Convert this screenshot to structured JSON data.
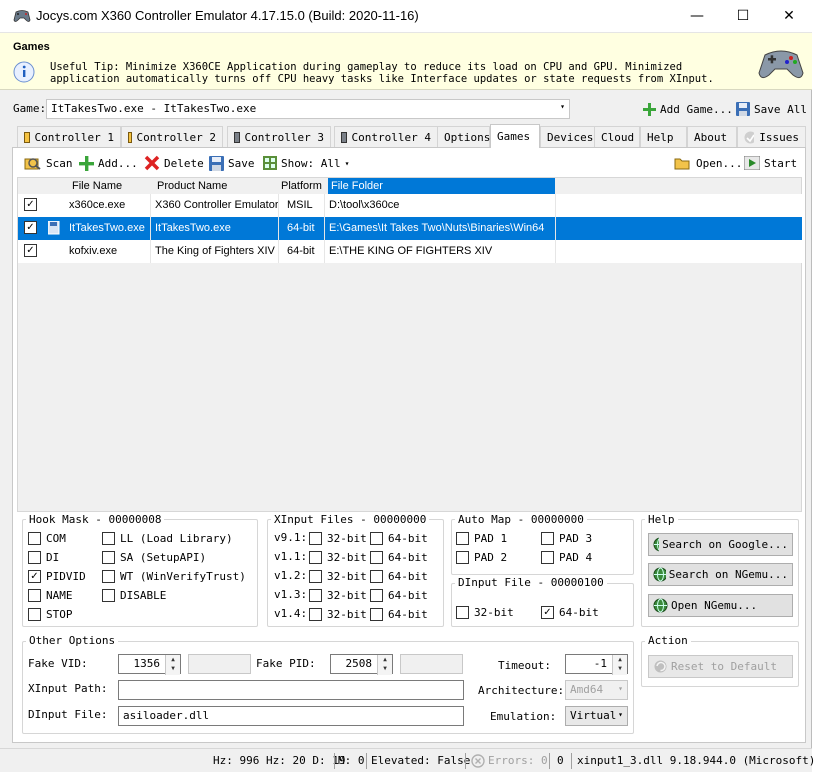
{
  "window": {
    "title": "Jocys.com X360 Controller Emulator 4.17.15.0 (Build: 2020-11-16)",
    "minimize": "—",
    "maximize": "☐",
    "close": "✕"
  },
  "info": {
    "title": "Games",
    "text": "Useful Tip: Minimize X360CE Application during gameplay to reduce its load on CPU and GPU. Minimized application automatically turns off CPU heavy tasks like Interface updates or state requests from XInput."
  },
  "game_bar": {
    "label": "Game:",
    "selected": "ItTakesTwo.exe - ItTakesTwo.exe",
    "add_game": "Add Game...",
    "save_all": "Save All"
  },
  "tabs": [
    {
      "label": "Controller 1",
      "active": false
    },
    {
      "label": "Controller 2",
      "active": false
    },
    {
      "label": "Controller 3",
      "active": false
    },
    {
      "label": "Controller 4",
      "active": false
    },
    {
      "label": "Options",
      "active": false
    },
    {
      "label": "Games",
      "active": true
    },
    {
      "label": "Devices",
      "active": false
    },
    {
      "label": "Cloud",
      "active": false
    },
    {
      "label": "Help",
      "active": false
    },
    {
      "label": "About",
      "active": false
    },
    {
      "label": "Issues",
      "active": false
    }
  ],
  "toolbar": {
    "scan": "Scan",
    "add": "Add...",
    "delete": "Delete",
    "save": "Save",
    "show": "Show: All",
    "open": "Open...",
    "start": "Start"
  },
  "grid": {
    "columns": [
      "File Name",
      "Product Name",
      "Platform",
      "File Folder"
    ],
    "rows": [
      {
        "checked": true,
        "file": "x360ce.exe",
        "product": "X360 Controller Emulator",
        "platform": "MSIL",
        "folder": "D:\\tool\\x360ce",
        "selected": false
      },
      {
        "checked": true,
        "file": "ItTakesTwo.exe",
        "product": "ItTakesTwo.exe",
        "platform": "64-bit",
        "folder": "E:\\Games\\It Takes Two\\Nuts\\Binaries\\Win64",
        "selected": true
      },
      {
        "checked": true,
        "file": "kofxiv.exe",
        "product": "The King of Fighters XIV",
        "platform": "64-bit",
        "folder": "E:\\THE KING OF FIGHTERS XIV",
        "selected": false
      }
    ]
  },
  "hook_mask": {
    "title": "Hook Mask - 00000008",
    "items": [
      {
        "label": "COM",
        "checked": false
      },
      {
        "label": "LL (Load Library)",
        "checked": false
      },
      {
        "label": "DI",
        "checked": false
      },
      {
        "label": "SA (SetupAPI)",
        "checked": false
      },
      {
        "label": "PIDVID",
        "checked": true
      },
      {
        "label": "WT (WinVerifyTrust)",
        "checked": false
      },
      {
        "label": "NAME",
        "checked": false
      },
      {
        "label": "DISABLE",
        "checked": false
      },
      {
        "label": "STOP",
        "checked": false
      }
    ]
  },
  "xinput_files": {
    "title": "XInput Files - 00000000",
    "rows": [
      {
        "version": "v9.1:",
        "b32": "32-bit",
        "b64": "64-bit"
      },
      {
        "version": "v1.1:",
        "b32": "32-bit",
        "b64": "64-bit"
      },
      {
        "version": "v1.2:",
        "b32": "32-bit",
        "b64": "64-bit"
      },
      {
        "version": "v1.3:",
        "b32": "32-bit",
        "b64": "64-bit"
      },
      {
        "version": "v1.4:",
        "b32": "32-bit",
        "b64": "64-bit"
      }
    ]
  },
  "auto_map": {
    "title": "Auto Map - 00000000",
    "pads": [
      "PAD 1",
      "PAD 3",
      "PAD 2",
      "PAD 4"
    ]
  },
  "dinput_file": {
    "title": "DInput File - 00000100",
    "b32": "32-bit",
    "b64": "64-bit"
  },
  "help": {
    "title": "Help",
    "google": "Search on Google...",
    "ngemu": "Search on NGemu...",
    "open_ngemu": "Open NGemu..."
  },
  "action": {
    "title": "Action",
    "reset": "Reset to Default"
  },
  "other": {
    "title": "Other Options",
    "fake_vid_label": "Fake VID:",
    "fake_vid": "1356",
    "fake_pid_label": "Fake PID:",
    "fake_pid": "2508",
    "timeout_label": "Timeout:",
    "timeout": "-1",
    "xinput_path_label": "XInput Path:",
    "xinput_path": "",
    "architecture_label": "Architecture:",
    "architecture": "Amd64",
    "dinput_file_label": "DInput File:",
    "dinput_file": "asiloader.dll",
    "emulation_label": "Emulation:",
    "emulation": "Virtual"
  },
  "status": {
    "hz": "Hz: 996 Hz: 20 D: 19",
    "m": "M: 0",
    "elevated": "Elevated: False",
    "errors": "Errors: 0",
    "zero": "0",
    "xinput": "xinput1_3.dll 9.18.944.0 (Microsoft)"
  }
}
